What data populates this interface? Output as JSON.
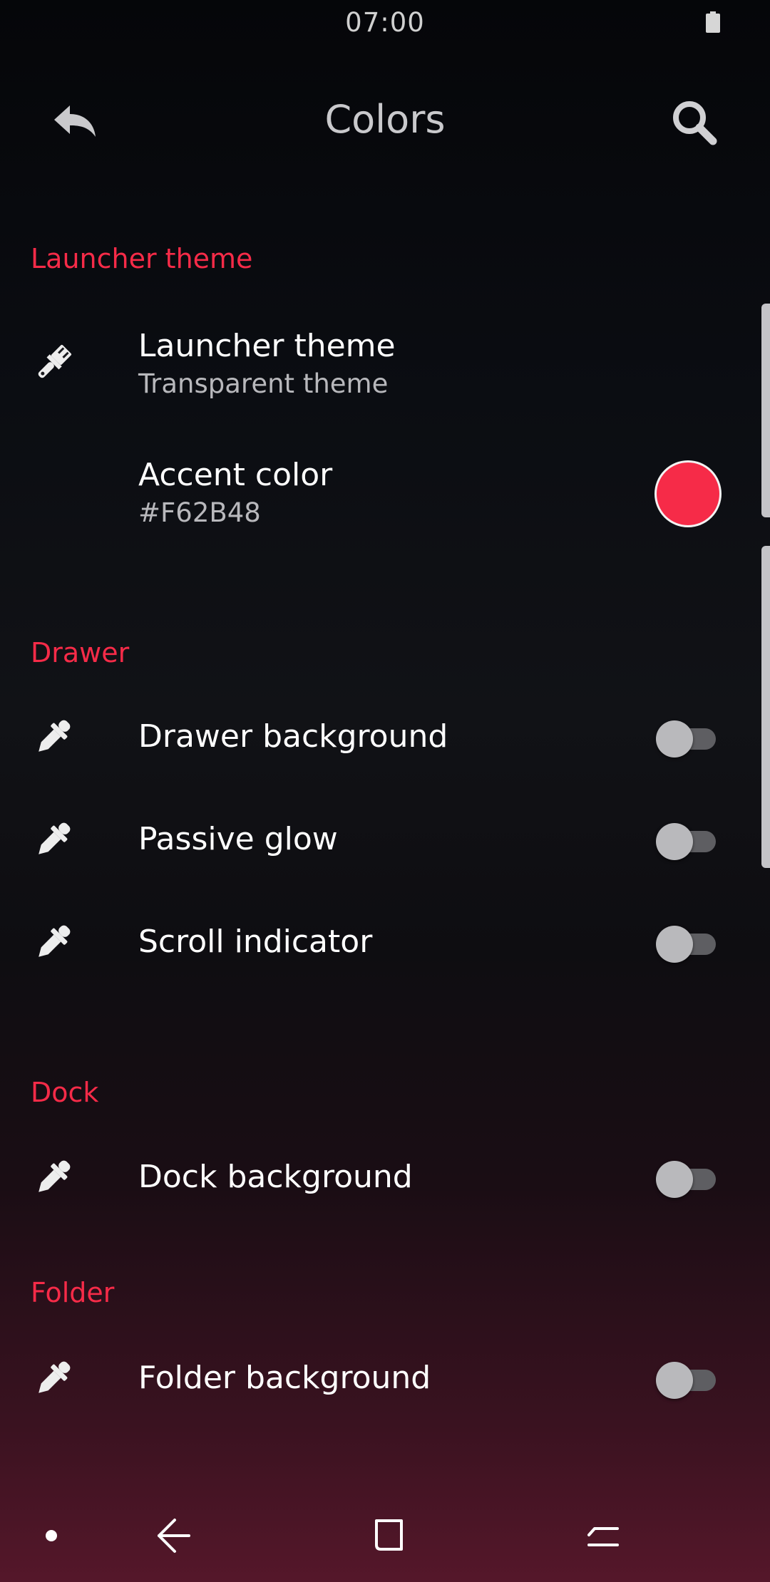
{
  "status_bar": {
    "time": "07:00",
    "battery_icon": "battery-full-icon"
  },
  "app_bar": {
    "title": "Colors",
    "back_icon": "reply-arrow-icon",
    "search_icon": "search-icon"
  },
  "sections": [
    {
      "header": "Launcher theme",
      "items": [
        {
          "icon": "paint-brush-icon",
          "title": "Launcher theme",
          "subtitle": "Transparent theme"
        },
        {
          "title": "Accent color",
          "subtitle": "#F62B48",
          "swatch_color": "#F62B48"
        }
      ]
    },
    {
      "header": "Drawer",
      "items": [
        {
          "icon": "eyedropper-icon",
          "title": "Drawer background",
          "toggle_on": false
        },
        {
          "icon": "eyedropper-icon",
          "title": "Passive glow",
          "toggle_on": false
        },
        {
          "icon": "eyedropper-icon",
          "title": "Scroll indicator",
          "toggle_on": false
        }
      ]
    },
    {
      "header": "Dock",
      "items": [
        {
          "icon": "eyedropper-icon",
          "title": "Dock background",
          "toggle_on": false
        }
      ]
    },
    {
      "header": "Folder",
      "items": [
        {
          "icon": "eyedropper-icon",
          "title": "Folder background",
          "toggle_on": false
        }
      ]
    }
  ],
  "nav_bar": {
    "items": [
      "dot-icon",
      "back-arrow-icon",
      "recents-icon",
      "switch-icon"
    ]
  },
  "colors": {
    "accent": "#F62B48",
    "background_top": "#050609",
    "background_bottom": "#55172A"
  }
}
